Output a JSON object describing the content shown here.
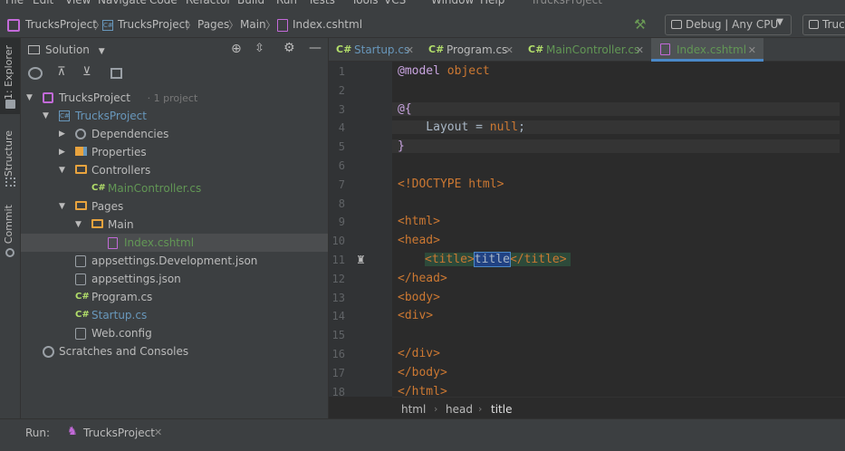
{
  "menu": [
    "File",
    "Edit",
    "View",
    "Navigate",
    "Code",
    "Refactor",
    "Build",
    "Run",
    "Tests",
    "Tools",
    "VCS",
    "Window",
    "Help"
  ],
  "window_title": "TrucksProject",
  "nav": {
    "crumbs": [
      "TrucksProject",
      "TrucksProject",
      "Pages",
      "Main",
      "Index.cshtml"
    ],
    "run_config": "Debug | Any CPU",
    "run_target": "Truc"
  },
  "strip": {
    "explorer": "1: Explorer",
    "structure": "Structure",
    "commit": "Commit"
  },
  "panel": {
    "title": "Solution",
    "tree": [
      {
        "label": "TrucksProject",
        "suffix": "· 1 project",
        "depth": 0,
        "arrow": "▼",
        "icon": "solution-icon",
        "color": "#bbbbbb"
      },
      {
        "label": "TrucksProject",
        "depth": 1,
        "arrow": "▼",
        "icon": "csharp-project-icon",
        "color": "#6897bb"
      },
      {
        "label": "Dependencies",
        "depth": 2,
        "arrow": "▶",
        "icon": "dependencies-icon",
        "color": "#bbbbbb"
      },
      {
        "label": "Properties",
        "depth": 2,
        "arrow": "▶",
        "icon": "properties-folder-icon",
        "color": "#bbbbbb"
      },
      {
        "label": "Controllers",
        "depth": 2,
        "arrow": "▼",
        "icon": "folder-icon",
        "color": "#bbbbbb"
      },
      {
        "label": "MainController.cs",
        "depth": 3,
        "arrow": "",
        "icon": "csharp-file-icon",
        "color": "#629755"
      },
      {
        "label": "Pages",
        "depth": 2,
        "arrow": "▼",
        "icon": "folder-icon",
        "color": "#bbbbbb"
      },
      {
        "label": "Main",
        "depth": 3,
        "arrow": "▼",
        "icon": "folder-icon",
        "color": "#bbbbbb"
      },
      {
        "label": "Index.cshtml",
        "depth": 4,
        "arrow": "",
        "icon": "cshtml-file-icon",
        "color": "#629755",
        "selected": true
      },
      {
        "label": "appsettings.Development.json",
        "depth": 2,
        "arrow": "",
        "icon": "json-file-icon",
        "color": "#bbbbbb"
      },
      {
        "label": "appsettings.json",
        "depth": 2,
        "arrow": "",
        "icon": "json-file-icon",
        "color": "#bbbbbb"
      },
      {
        "label": "Program.cs",
        "depth": 2,
        "arrow": "",
        "icon": "csharp-file-icon",
        "color": "#bbbbbb"
      },
      {
        "label": "Startup.cs",
        "depth": 2,
        "arrow": "",
        "icon": "csharp-file-icon",
        "color": "#6897bb"
      },
      {
        "label": "Web.config",
        "depth": 2,
        "arrow": "",
        "icon": "config-file-icon",
        "color": "#bbbbbb"
      },
      {
        "label": "Scratches and Consoles",
        "depth": 0,
        "arrow": "",
        "icon": "scratches-icon",
        "color": "#bbbbbb"
      }
    ]
  },
  "tabs": [
    {
      "prefix": "C#",
      "label": "Startup.cs",
      "color": "#6897bb",
      "active": false
    },
    {
      "prefix": "C#",
      "label": "Program.cs",
      "color": "#bbbbbb",
      "active": false
    },
    {
      "prefix": "C#",
      "label": "MainController.cs",
      "color": "#629755",
      "active": false
    },
    {
      "prefix": "",
      "label": "Index.cshtml",
      "color": "#629755",
      "active": true
    }
  ],
  "editor": {
    "lines": [
      [
        [
          "dir",
          "@model"
        ],
        [
          "txt",
          " "
        ],
        [
          "kw2",
          "object"
        ]
      ],
      [],
      [
        [
          "dir",
          "@{"
        ]
      ],
      [
        [
          "txt",
          "    Layout = "
        ],
        [
          "kw2",
          "null"
        ],
        [
          "txt",
          ";"
        ]
      ],
      [
        [
          "dir",
          "}"
        ]
      ],
      [],
      [
        [
          "kw2",
          "<!DOCTYPE"
        ],
        [
          "txt",
          " "
        ],
        [
          "kw2",
          "html"
        ],
        [
          "kw2",
          ">"
        ]
      ],
      [],
      [
        [
          "kw2",
          "<html>"
        ]
      ],
      [
        [
          "kw2",
          "<head>"
        ]
      ],
      [
        [
          "txt",
          "    "
        ],
        [
          "kw2",
          "<title>"
        ],
        [
          "sel",
          "title"
        ],
        [
          "kw2",
          "</title>"
        ]
      ],
      [
        [
          "kw2",
          "</head>"
        ]
      ],
      [
        [
          "kw2",
          "<body>"
        ]
      ],
      [
        [
          "kw2",
          "<div>"
        ]
      ],
      [],
      [
        [
          "kw2",
          "</div>"
        ]
      ],
      [
        [
          "kw2",
          "</body>"
        ]
      ],
      [
        [
          "kw2",
          "</html>"
        ]
      ]
    ]
  },
  "code_crumbs": [
    "html",
    "head",
    "title"
  ],
  "run": {
    "label": "Run:",
    "config": "TrucksProject"
  }
}
